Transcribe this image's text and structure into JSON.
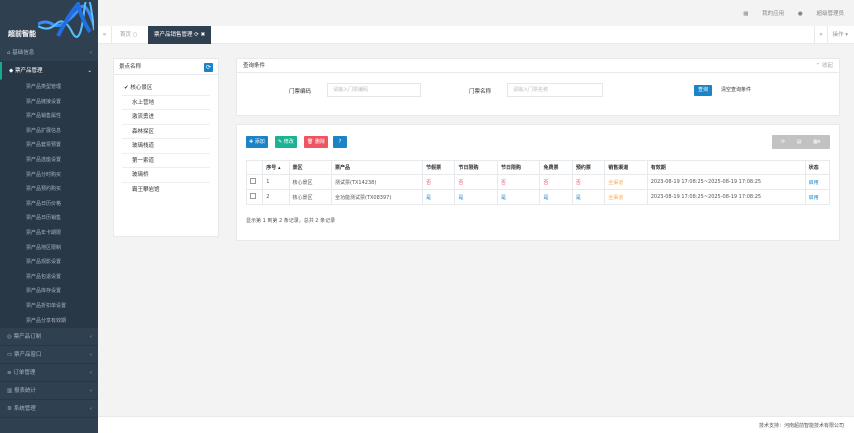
{
  "brand": {
    "name": "超前智能"
  },
  "sidebar": {
    "groups_top": [
      {
        "label": "基础信息",
        "icon": "home-icon"
      }
    ],
    "active_group": {
      "label": "票产品管理",
      "icon": "ticket-icon"
    },
    "items": [
      "票产品类型管理",
      "票产品链接设置",
      "票产品销售属性",
      "票产品扩展信息",
      "票产品套票预置",
      "票产品选座设置",
      "票产品分时购买",
      "票产品预约购买",
      "票产品日历价格",
      "票产品日历销售",
      "票产品年卡期限",
      "票产品地区限制",
      "票产品观影设置",
      "票产品包退设置",
      "票产品库存设置",
      "票产品折扣单设置",
      "票产品分享有效期"
    ],
    "groups_bottom": [
      {
        "label": "票产品订制",
        "icon": "globe-icon"
      },
      {
        "label": "票产品窗口",
        "icon": "monitor-icon"
      },
      {
        "label": "订单管理",
        "icon": "list-icon"
      },
      {
        "label": "报表统计",
        "icon": "chart-icon"
      },
      {
        "label": "系统管理",
        "icon": "gear-icon"
      }
    ]
  },
  "topbar": {
    "apps": "我的应用",
    "user": "超级管理员"
  },
  "tabs": {
    "home": "首页",
    "active": "票产品销售管理",
    "ops": "操作"
  },
  "tree": {
    "title": "景点名称",
    "items": [
      "核心景区",
      "水上营地",
      "激流勇进",
      "森林探区",
      "玻璃栈道",
      "第一索道",
      "玻璃桥",
      "霸王攀岩馆"
    ]
  },
  "query": {
    "title": "查询条件",
    "collapse": "收起",
    "ticket_code_label": "门票编码",
    "ticket_code_placeholder": "请输入门票编码",
    "ticket_name_label": "门票名称",
    "ticket_name_placeholder": "请输入门票名称",
    "search": "查询",
    "reset": "清空查询条件"
  },
  "toolbar": {
    "add": "添加",
    "edit": "修改",
    "delete": "删除"
  },
  "table": {
    "headers": [
      "序号",
      "景区",
      "票产品",
      "节假票",
      "节日限购",
      "节日限购",
      "免费票",
      "预约票",
      "销售渠道",
      "有效期",
      "状态"
    ],
    "rows": [
      {
        "no": "1",
        "scenic": "核心景区",
        "product": "测试票(TX14238)",
        "c1": "否",
        "c2": "否",
        "c3": "否",
        "c4": "否",
        "c5": "否",
        "channel": "全渠道",
        "valid": "2023-08-19 17:08:25~2025-08-19 17:08:25",
        "status": "启用"
      },
      {
        "no": "2",
        "scenic": "核心景区",
        "product": "全功能测试票(TX08397)",
        "c1": "是",
        "c2": "是",
        "c3": "是",
        "c4": "是",
        "c5": "是",
        "channel": "全渠道",
        "valid": "2023-08-19 17:08:25~2025-08-19 17:08:25",
        "status": "启用"
      }
    ],
    "summary": "显示第 1 到第 2 条记录，总共 2 条记录"
  },
  "footer": {
    "text": "技术支持：河南超前智能技术有限公司"
  }
}
